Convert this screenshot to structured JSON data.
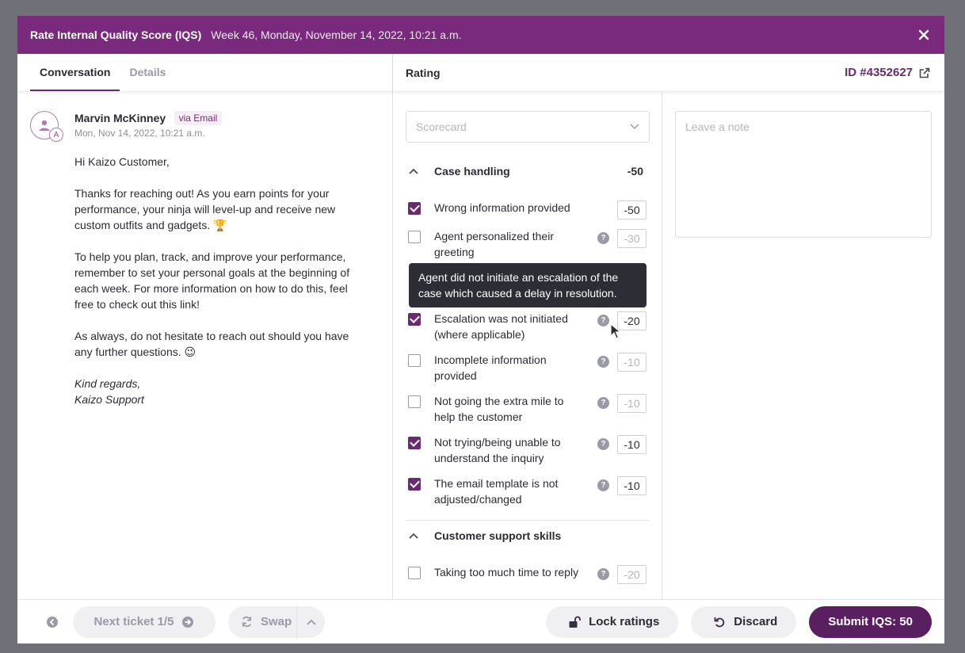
{
  "header": {
    "title": "Rate Internal Quality Score (IQS)",
    "subtitle": "Week 46, Monday, November 14, 2022, 10:21 a.m."
  },
  "tabs": [
    {
      "label": "Conversation",
      "active": true
    },
    {
      "label": "Details",
      "active": false
    }
  ],
  "message": {
    "avatar_badge": "A",
    "sender": "Marvin McKinney",
    "channel": "via Email",
    "date": "Mon, Nov 14, 2022, 10:21 a.m.",
    "greeting": "Hi Kaizo Customer,",
    "p1": "Thanks for reaching out! As you earn points for your performance, your ninja will level-up and receive new custom outfits and gadgets. 🏆",
    "p2": "To help you plan, track, and improve your performance, remember to set your personal goals at the beginning of each week. For more information on how to do this, feel free to check out this link!",
    "p3": "As always, do not hesitate to reach out should you have any further questions. 😉",
    "sign1": "Kind regards,",
    "sign2": "Kaizo Support"
  },
  "rating": {
    "label": "Rating",
    "ticket_id": "ID #4352627",
    "scorecard_placeholder": "Scorecard",
    "note_placeholder": "Leave a note",
    "sections": [
      {
        "name": "Case handling",
        "total": "-50",
        "items": [
          {
            "label": "Wrong information provided",
            "score": "-50",
            "checked": true,
            "help": false
          },
          {
            "label": "Agent personalized their greeting",
            "score": "-30",
            "checked": false,
            "help": true
          },
          {
            "label": "Escalation was not initiated (where applicable)",
            "score": "-20",
            "checked": true,
            "help": true
          },
          {
            "label": "Incomplete information provided",
            "score": "-10",
            "checked": false,
            "help": true
          },
          {
            "label": "Not going the extra mile to help the customer",
            "score": "-10",
            "checked": false,
            "help": true
          },
          {
            "label": "Not trying/being unable to understand the inquiry",
            "score": "-10",
            "checked": true,
            "help": true
          },
          {
            "label": "The email template is not adjusted/changed",
            "score": "-10",
            "checked": true,
            "help": true
          }
        ]
      },
      {
        "name": "Customer support skills",
        "items": [
          {
            "label": "Taking too much time to reply",
            "score": "-20",
            "checked": false,
            "help": true
          }
        ]
      }
    ],
    "tooltip": "Agent did not initiate an escalation of the case which caused a delay in resolution."
  },
  "footer": {
    "next_ticket": "Next ticket 1/5",
    "swap": "Swap",
    "lock": "Lock ratings",
    "discard": "Discard",
    "submit": "Submit IQS: 50"
  },
  "colors": {
    "header_bg": "#7a2a7d",
    "accent": "#6a2a70",
    "submit_bg": "#5a1f61"
  }
}
